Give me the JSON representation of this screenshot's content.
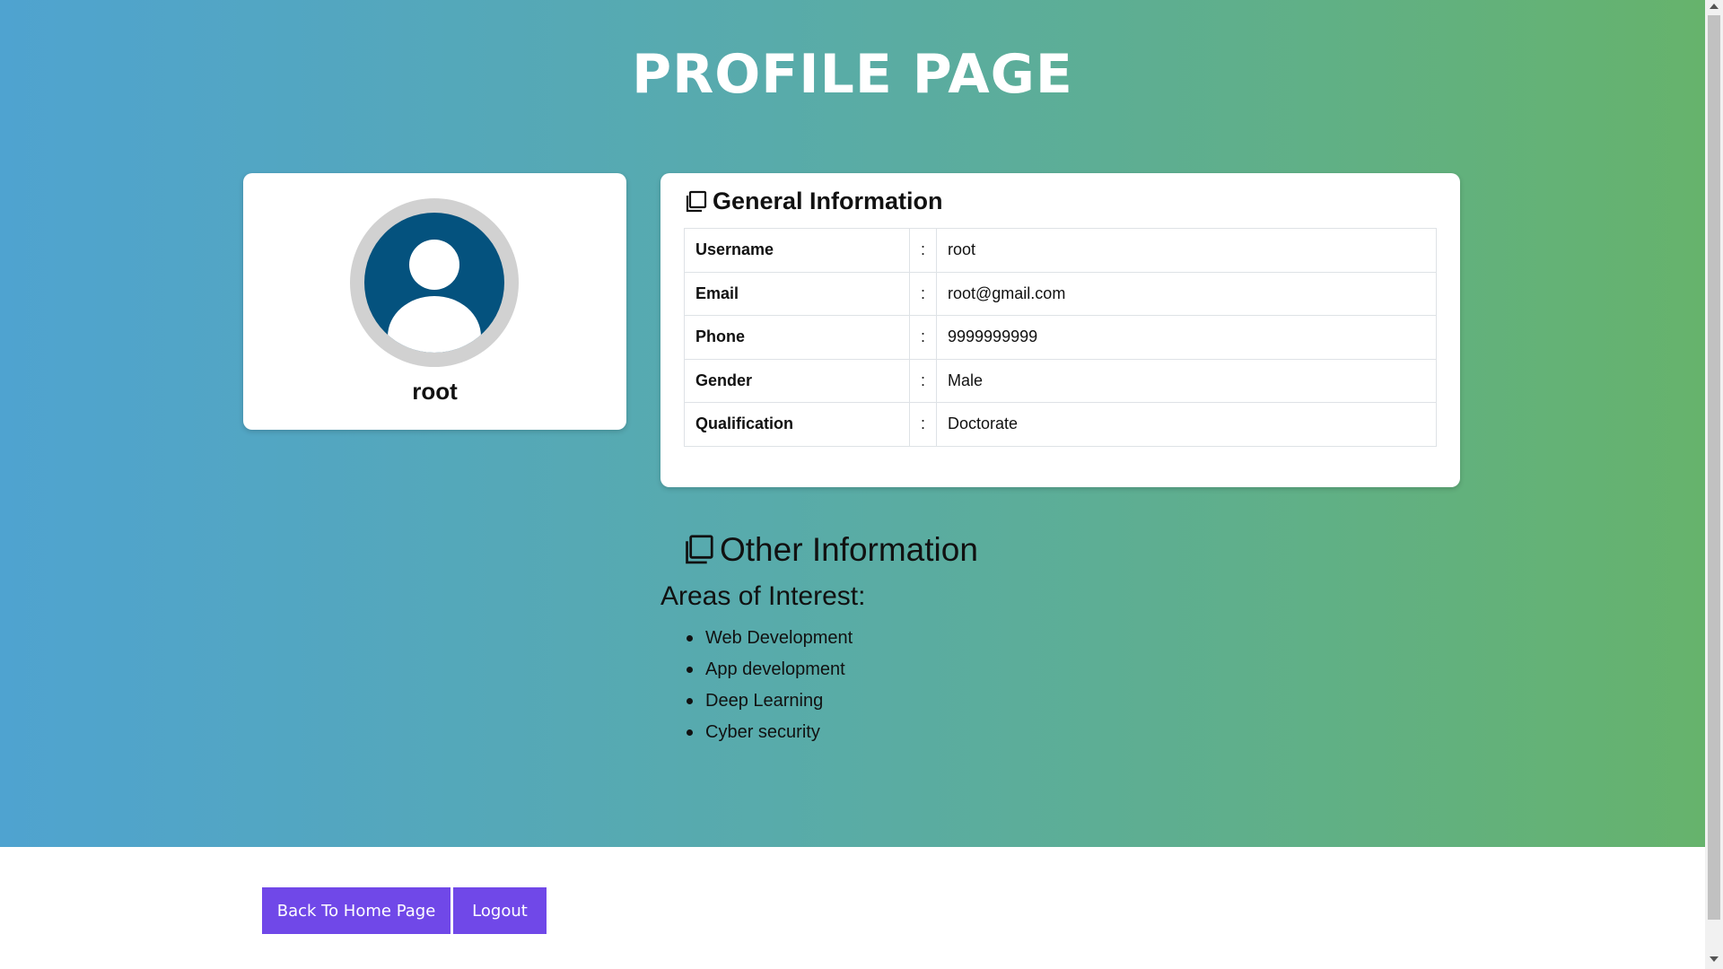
{
  "page": {
    "title": "PROFILE PAGE"
  },
  "profile": {
    "name": "root",
    "avatar_icon": "user-avatar-icon"
  },
  "general_info": {
    "heading": "General Information",
    "icon": "copy-icon",
    "separator": ":",
    "rows": [
      {
        "label": "Username",
        "value": "root"
      },
      {
        "label": "Email",
        "value": "root@gmail.com"
      },
      {
        "label": "Phone",
        "value": "9999999999"
      },
      {
        "label": "Gender",
        "value": "Male"
      },
      {
        "label": "Qualification",
        "value": "Doctorate"
      }
    ]
  },
  "other_info": {
    "heading": "Other Information",
    "icon": "copy-icon",
    "areas_title": "Areas of Interest:",
    "interests": [
      "Web Development",
      "App development",
      "Deep Learning",
      "Cyber security"
    ]
  },
  "actions": {
    "home_label": "Back To Home Page",
    "logout_label": "Logout"
  },
  "colors": {
    "gradient_start": "#4fa3d0",
    "gradient_end": "#66b36c",
    "button": "#7048e8",
    "avatar": "#04527e"
  }
}
